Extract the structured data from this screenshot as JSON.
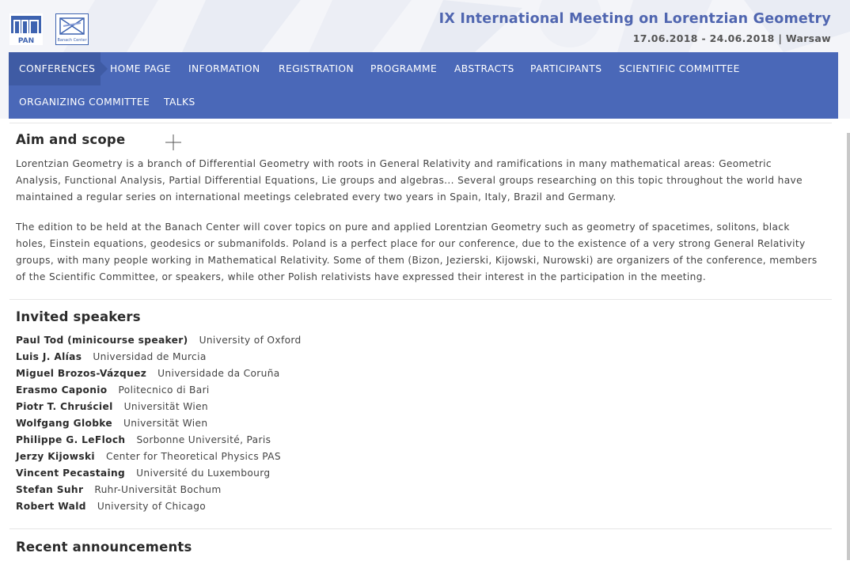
{
  "header": {
    "title": "IX International Meeting on Lorentzian Geometry",
    "subtitle": "17.06.2018 - 24.06.2018 | Warsaw",
    "logo_pan_text": "PAN",
    "logo_banach_text": "Banach Center"
  },
  "nav": {
    "items": [
      "CONFERENCES",
      "HOME PAGE",
      "INFORMATION",
      "REGISTRATION",
      "PROGRAMME",
      "ABSTRACTS",
      "PARTICIPANTS",
      "SCIENTIFIC COMMITTEE",
      "ORGANIZING COMMITTEE",
      "TALKS"
    ],
    "active": "CONFERENCES"
  },
  "aim": {
    "heading": "Aim and scope",
    "p1": "Lorentzian Geometry is a branch of Differential Geometry with roots in General Relativity and ramifications in many mathematical areas: Geometric Analysis, Functional Analysis, Partial Differential Equations, Lie groups and algebras... Several groups researching on this topic throughout the world have maintained a regular series on international meetings celebrated every two years in Spain, Italy, Brazil and Germany.",
    "p2": "The edition to be held at the Banach Center will cover topics on pure and applied Lorentzian Geometry such as geometry of spacetimes, solitons, black holes, Einstein equations, geodesics or submanifolds. Poland is a perfect place for our conference, due to the existence of a very strong General Relativity groups, with many people working in Mathematical Relativity. Some of them (Bizon, Jezierski, Kijowski, Nurowski) are organizers of the conference, members of the Scientific Committee, or speakers, while other Polish relativists have expressed their interest in the participation in the meeting."
  },
  "speakers": {
    "heading": "Invited speakers",
    "list": [
      {
        "name": "Paul Tod  (minicourse speaker)",
        "affiliation": "University of Oxford"
      },
      {
        "name": "Luis J. Alías",
        "affiliation": "Universidad de Murcia"
      },
      {
        "name": "Miguel Brozos-Vázquez",
        "affiliation": "Universidade da Coruña"
      },
      {
        "name": "Erasmo Caponio",
        "affiliation": "Politecnico di Bari"
      },
      {
        "name": "Piotr T. Chruściel",
        "affiliation": "Universität Wien"
      },
      {
        "name": "Wolfgang Globke",
        "affiliation": "Universität Wien"
      },
      {
        "name": "Philippe G. LeFloch",
        "affiliation": "Sorbonne Université, Paris"
      },
      {
        "name": "Jerzy Kijowski",
        "affiliation": "Center for Theoretical Physics PAS"
      },
      {
        "name": "Vincent Pecastaing",
        "affiliation": "Université du Luxembourg"
      },
      {
        "name": "Stefan Suhr",
        "affiliation": "Ruhr-Universität Bochum"
      },
      {
        "name": "Robert Wald",
        "affiliation": "University of Chicago"
      }
    ]
  },
  "announcements": {
    "heading": "Recent announcements"
  },
  "colors": {
    "nav_bg": "#4a68b8",
    "nav_active": "#3f5ba4",
    "title": "#5066b0"
  }
}
